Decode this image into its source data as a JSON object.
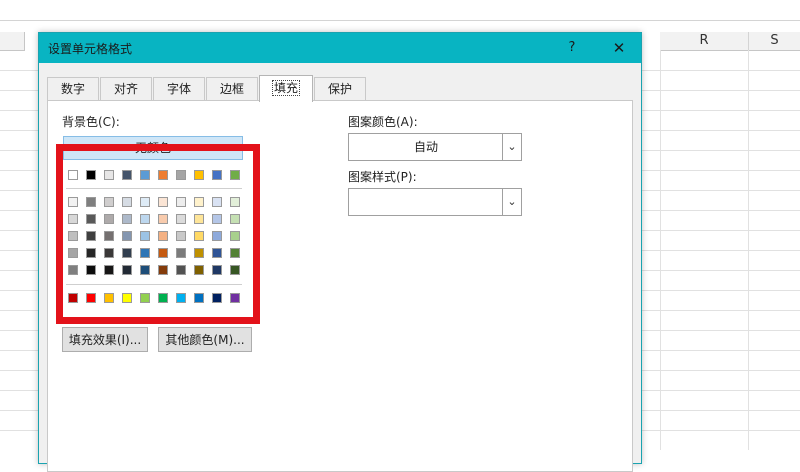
{
  "spreadsheet": {
    "columns": [
      {
        "label": "R"
      },
      {
        "label": "S"
      }
    ]
  },
  "dialog": {
    "title": "设置单元格格式",
    "help_label": "?",
    "close_label": "✕",
    "tabs": [
      {
        "label": "数字"
      },
      {
        "label": "对齐"
      },
      {
        "label": "字体"
      },
      {
        "label": "边框"
      },
      {
        "label": "填充",
        "active": true
      },
      {
        "label": "保护"
      }
    ],
    "fill": {
      "background_color_label": "背景色(C):",
      "no_color_label": "无颜色",
      "theme_top_row": [
        "#ffffff",
        "#000000",
        "#e7e6e6",
        "#44546a",
        "#5b9bd5",
        "#ed7d31",
        "#a5a5a5",
        "#ffc000",
        "#4472c4",
        "#70ad47"
      ],
      "theme_shades": [
        [
          "#f2f2f2",
          "#7f7f7f",
          "#d0cece",
          "#d6dce4",
          "#deebf6",
          "#fbe5d5",
          "#ededed",
          "#fff2cc",
          "#d9e2f3",
          "#e2efd9"
        ],
        [
          "#d8d8d8",
          "#595959",
          "#aeaaaa",
          "#adb9ca",
          "#bdd7ee",
          "#f8cbad",
          "#dbdbdb",
          "#fee599",
          "#b4c6e7",
          "#c5e0b3"
        ],
        [
          "#bfbfbf",
          "#3f3f3f",
          "#757070",
          "#8496b0",
          "#9cc3e5",
          "#f4b183",
          "#c9c9c9",
          "#ffd965",
          "#8eaadb",
          "#a8d08d"
        ],
        [
          "#a5a5a5",
          "#262626",
          "#3a3838",
          "#323f4f",
          "#2e75b5",
          "#c55a11",
          "#7b7b7b",
          "#bf9000",
          "#2f5496",
          "#538135"
        ],
        [
          "#7f7f7f",
          "#0c0c0c",
          "#171616",
          "#222a35",
          "#1e4e79",
          "#843c0b",
          "#525252",
          "#7f6000",
          "#1f3864",
          "#375623"
        ]
      ],
      "standard_colors": [
        "#c00000",
        "#ff0000",
        "#ffc000",
        "#ffff00",
        "#92d050",
        "#00b050",
        "#00b0f0",
        "#0070c0",
        "#002060",
        "#7030a0"
      ],
      "fill_effects_label": "填充效果(I)...",
      "more_colors_label": "其他颜色(M)...",
      "pattern_color_label": "图案颜色(A):",
      "pattern_color_value": "自动",
      "pattern_style_label": "图案样式(P):",
      "pattern_style_value": ""
    }
  },
  "colors": {
    "titlebar": "#08b4c2",
    "highlight_frame": "#e3121a"
  }
}
